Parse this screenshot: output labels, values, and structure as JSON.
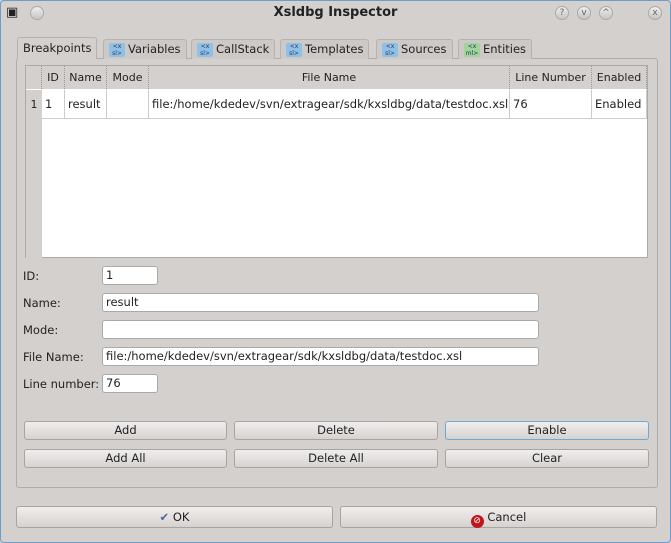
{
  "window": {
    "title": "Xsldbg Inspector",
    "controls": [
      "?",
      "v",
      "^",
      "x"
    ]
  },
  "tabs": [
    {
      "label": "Breakpoints",
      "active": true
    },
    {
      "label": "Variables",
      "icon": "xsl-icon"
    },
    {
      "label": "CallStack",
      "icon": "xsl-icon"
    },
    {
      "label": "Templates",
      "icon": "xsl-icon"
    },
    {
      "label": "Sources",
      "icon": "xsl-icon"
    },
    {
      "label": "Entities",
      "icon": "xml-icon"
    }
  ],
  "table": {
    "columns": [
      "ID",
      "Name",
      "Mode",
      "File Name",
      "Line Number",
      "Enabled"
    ],
    "rows": [
      {
        "row": "1",
        "id": "1",
        "name": "result",
        "mode": "",
        "file": "file:/home/kdedev/svn/extragear/sdk/kxsldbg/data/testdoc.xsl",
        "line": "76",
        "enabled": "Enabled"
      }
    ]
  },
  "form": {
    "id_label": "ID:",
    "id": "1",
    "name_label": "Name:",
    "name": "result",
    "mode_label": "Mode:",
    "mode": "",
    "file_label": "File Name:",
    "file": "file:/home/kdedev/svn/extragear/sdk/kxsldbg/data/testdoc.xsl",
    "line_label": "Line number:",
    "line": "76"
  },
  "buttons": {
    "add": "Add",
    "delete": "Delete",
    "enable": "Enable",
    "add_all": "Add All",
    "delete_all": "Delete All",
    "clear": "Clear",
    "ok": "OK",
    "cancel": "Cancel"
  }
}
